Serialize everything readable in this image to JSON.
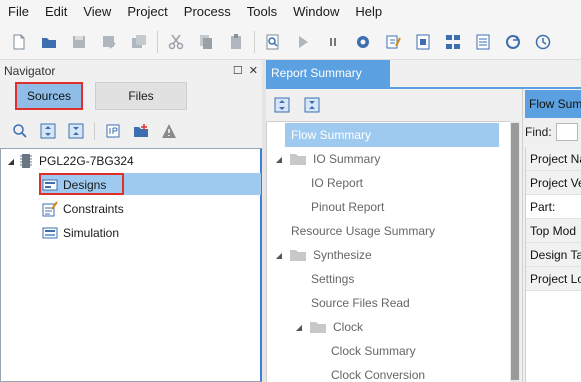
{
  "menu": [
    "File",
    "Edit",
    "View",
    "Project",
    "Process",
    "Tools",
    "Window",
    "Help"
  ],
  "toolbar_icons": [
    "new-file-icon",
    "open-folder-icon",
    "save-icon",
    "save-as-icon",
    "save-all-icon",
    "cut-icon",
    "copy-icon",
    "paste-icon",
    "find-icon",
    "run-icon",
    "pause-icon",
    "settings-gear-icon",
    "edit-notes-icon",
    "report-icon",
    "hierarchy-icon",
    "checklist-icon",
    "refresh-icon",
    "clock-icon"
  ],
  "navigator": {
    "title": "Navigator",
    "title_buttons": [
      "☐",
      "✕"
    ],
    "tabs": [
      {
        "label": "Sources"
      },
      {
        "label": "Files"
      }
    ],
    "toolbar_icons": [
      "search-icon",
      "expand-all-icon",
      "collapse-all-icon",
      "ip-icon",
      "add-source-icon",
      "warning-icon"
    ],
    "tree": {
      "root": "PGL22G-7BG324",
      "children": [
        "Designs",
        "Constraints",
        "Simulation"
      ]
    }
  },
  "report": {
    "tab_label": "Report Summary",
    "toolbar_icons": [
      "expand-all-icon",
      "collapse-all-icon"
    ],
    "tree": [
      {
        "label": "Flow Summary",
        "selected": true
      },
      {
        "label": "IO Summary",
        "folder": true
      },
      {
        "label": "IO Report"
      },
      {
        "label": "Pinout Report"
      },
      {
        "label": "Resource Usage Summary"
      },
      {
        "label": "Synthesize",
        "folder": true
      },
      {
        "label": "Settings"
      },
      {
        "label": "Source Files Read"
      },
      {
        "label": "Clock",
        "folder": true
      },
      {
        "label": "Clock Summary"
      },
      {
        "label": "Clock Conversion"
      }
    ]
  },
  "flow_summary": {
    "tab_label": "Flow Summ",
    "find_label": "Find:",
    "rows": [
      "Project Na",
      "Project Ve",
      "Part:",
      "Top Mod",
      "Design Ta",
      "Project Lo"
    ]
  },
  "colors": {
    "accent_blue": "#5ba0e0",
    "selection_blue": "#9fcaf0",
    "highlight_red": "#e0302c"
  }
}
